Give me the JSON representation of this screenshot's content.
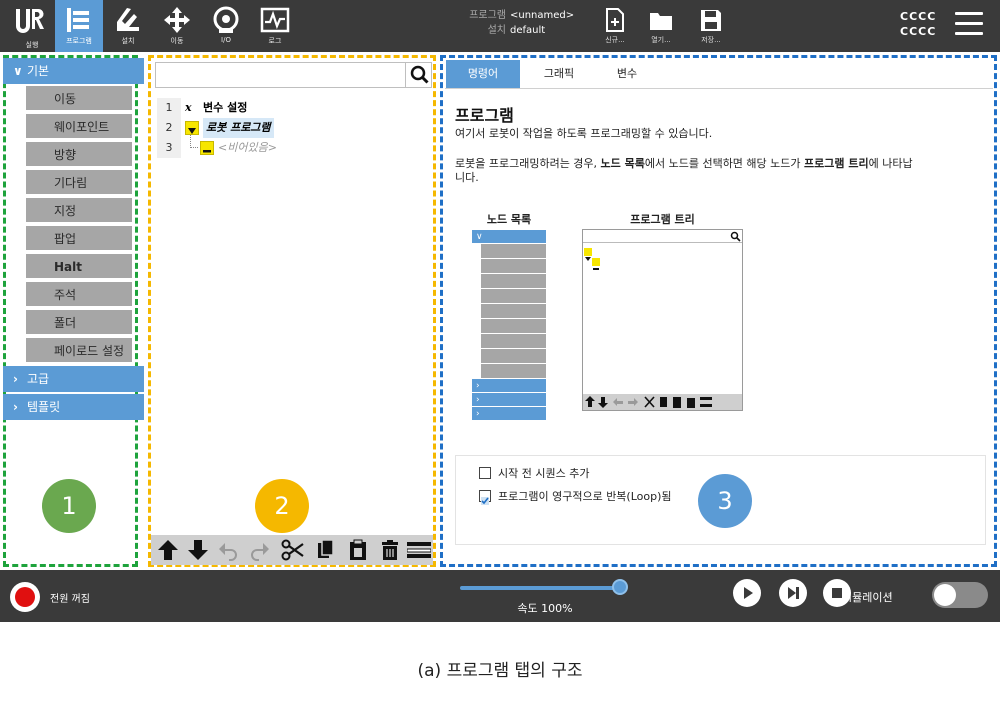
{
  "topbar": {
    "nav": [
      {
        "label": "실행",
        "icon": "run-icon"
      },
      {
        "label": "프로그램",
        "icon": "program-icon"
      },
      {
        "label": "설치",
        "icon": "installation-icon"
      },
      {
        "label": "이동",
        "icon": "move-icon"
      },
      {
        "label": "I/O",
        "icon": "io-icon"
      },
      {
        "label": "로그",
        "icon": "log-icon"
      }
    ],
    "file_info": {
      "program_key": "프로그램",
      "program_val": "<unnamed>",
      "install_key": "설치",
      "install_val": "default"
    },
    "file_buttons": [
      {
        "label": "신규...",
        "icon": "new-file-icon"
      },
      {
        "label": "열기...",
        "icon": "open-folder-icon"
      },
      {
        "label": "저장...",
        "icon": "save-icon"
      }
    ],
    "robot_name": [
      "CCCC",
      "CCCC"
    ]
  },
  "panel1": {
    "categories": {
      "basic": "기본",
      "advanced": "고급",
      "templates": "템플릿"
    },
    "nodes": [
      "이동",
      "웨이포인트",
      "방향",
      "기다림",
      "지정",
      "팝업",
      "Halt",
      "주석",
      "폴더",
      "페이로드 설정"
    ]
  },
  "panel2": {
    "tree": [
      {
        "line": "1",
        "icon": "variable-x-icon",
        "symbol": "x",
        "label": "변수 설정"
      },
      {
        "line": "2",
        "icon": "collapse-arrow-icon",
        "label": "로봇 프로그램"
      },
      {
        "line": "3",
        "icon": "empty-node-icon",
        "label": "<비어있음>"
      }
    ]
  },
  "panel3": {
    "tabs": [
      "명령어",
      "그래픽",
      "변수"
    ],
    "title": "프로그램",
    "desc1": "여기서 로봇이 작업을 하도록 프로그래밍할 수 있습니다.",
    "desc2_parts": [
      "로봇을 프로그래밍하려는 경우, ",
      "노드 목록",
      "에서 노드를 선택하면 해당 노드가 ",
      "프로그램 트리",
      "에 나타납",
      "니다."
    ],
    "mini_nodes_label": "노드 목록",
    "mini_tree_label": "프로그램 트리",
    "options": [
      {
        "label": "시작 전 시퀀스 추가",
        "checked": false
      },
      {
        "label": "프로그램이 영구적으로 반복(Loop)됨",
        "checked": true
      }
    ]
  },
  "badges": [
    "1",
    "2",
    "3"
  ],
  "bottombar": {
    "power_label": "전원 꺼짐",
    "speed_label": "속도 100%",
    "speed_value": 100,
    "simulation_label": "시뮬레이션",
    "simulation_on": false
  },
  "caption": "(a) 프로그램 탭의 구조",
  "colors": {
    "accent_blue": "#5b9bd5",
    "node_gray": "#a6a6a6",
    "panel1_border": "#1ea33c",
    "panel2_border": "#f5b800",
    "panel3_border": "#1f6fc6",
    "badge1": "#6aa84f",
    "badge2": "#f5b800",
    "badge3": "#5b9bd5",
    "power_red": "#e01010"
  }
}
